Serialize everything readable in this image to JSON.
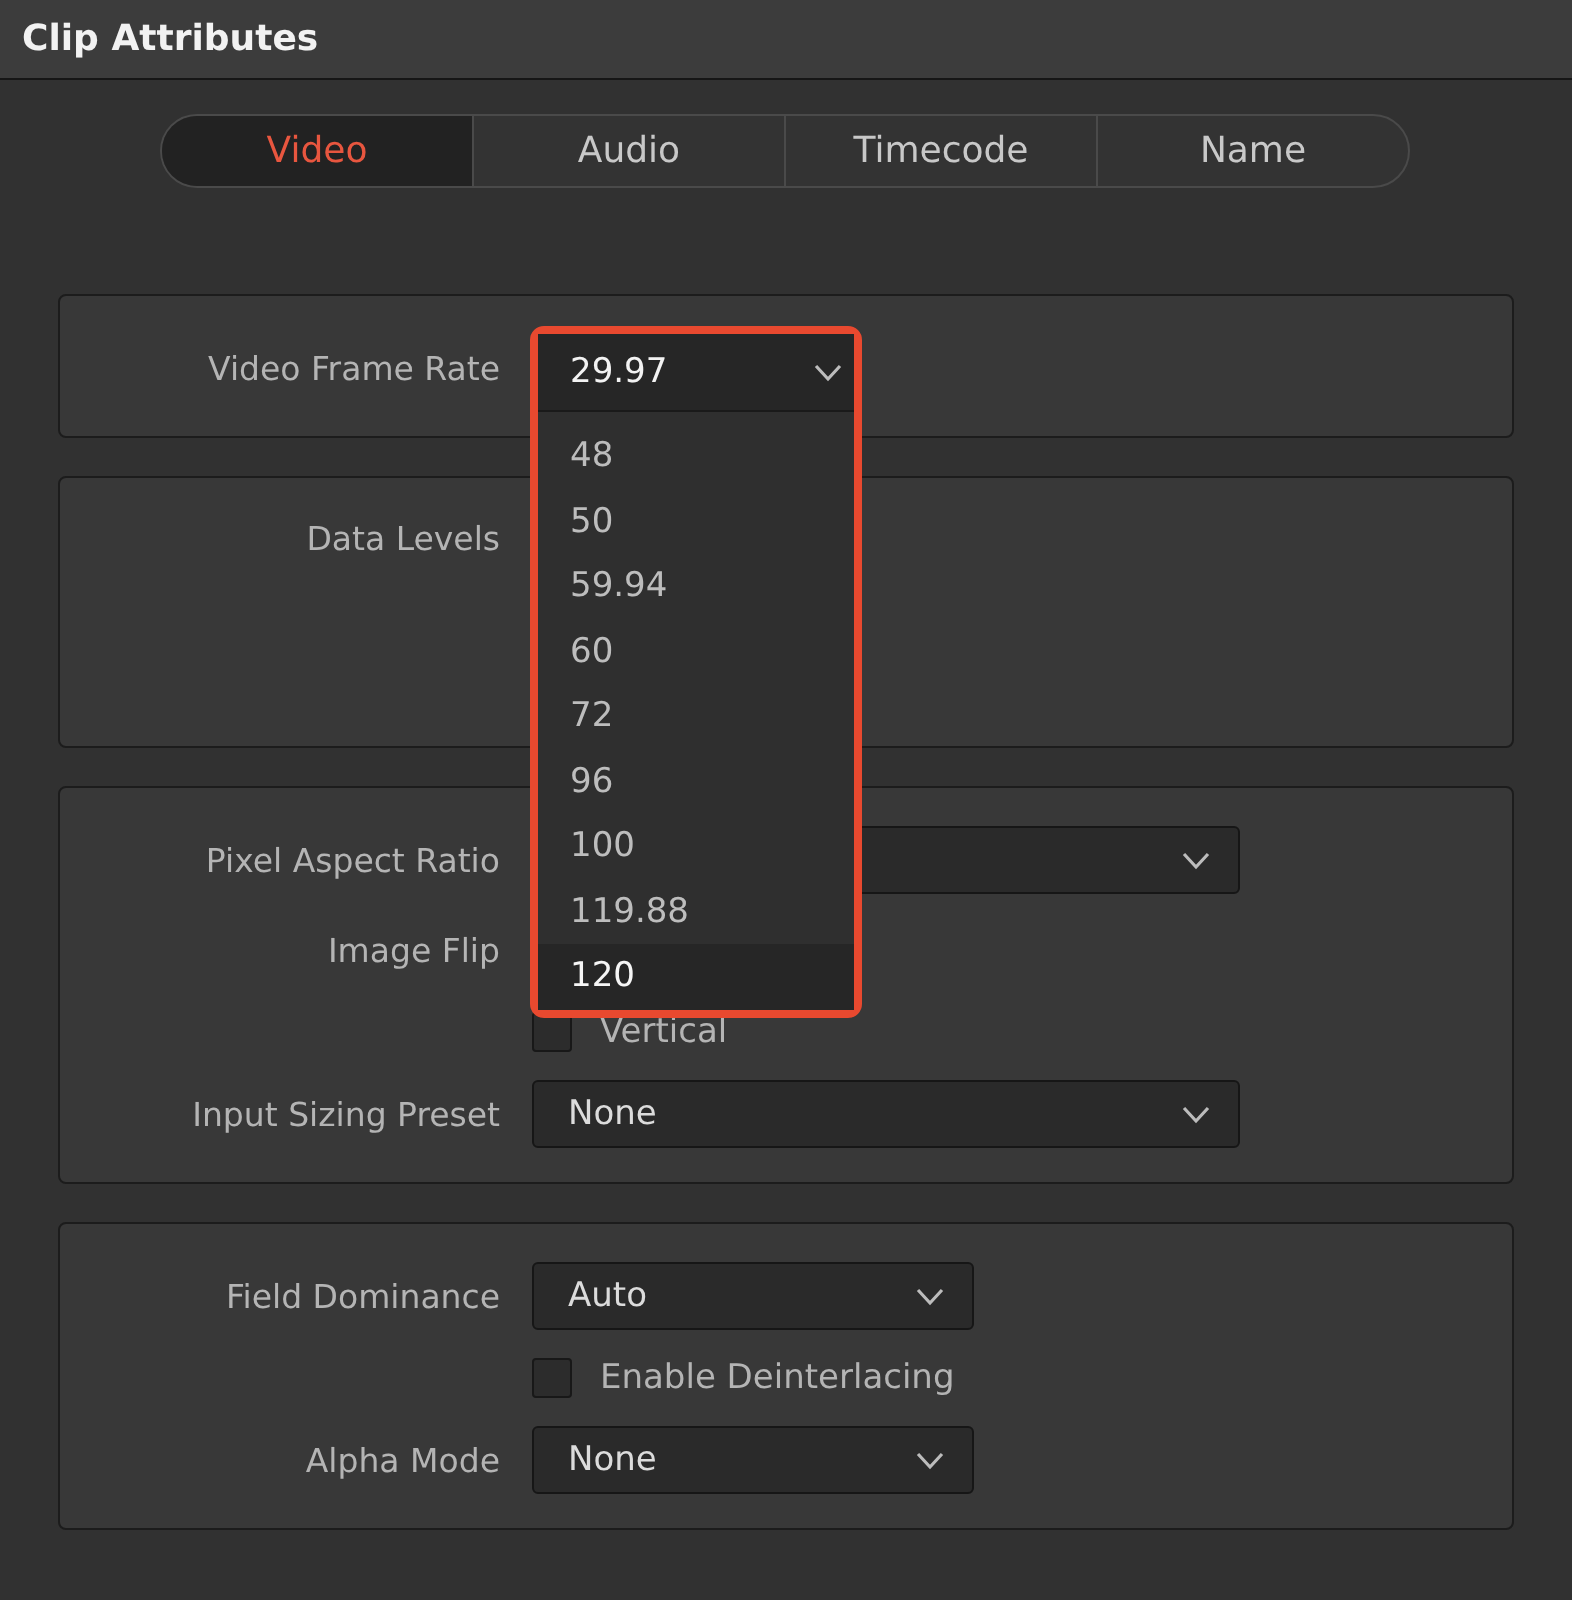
{
  "window": {
    "title": "Clip Attributes"
  },
  "tabs": [
    {
      "label": "Video",
      "selected": true
    },
    {
      "label": "Audio",
      "selected": false
    },
    {
      "label": "Timecode",
      "selected": false
    },
    {
      "label": "Name",
      "selected": false
    }
  ],
  "sections": [
    {
      "rows": [
        {
          "kind": "open-select",
          "label": "Video Frame Rate"
        }
      ]
    },
    {
      "rows": [
        {
          "kind": "label",
          "label": "Data Levels"
        }
      ]
    },
    {
      "rows": [
        {
          "kind": "select",
          "label": "Pixel Aspect Ratio"
        },
        {
          "kind": "label",
          "label": "Image Flip"
        },
        {
          "kind": "checkbox",
          "text": "Vertical",
          "checked": false
        },
        {
          "kind": "select",
          "label": "Input Sizing Preset",
          "value": "None"
        }
      ]
    },
    {
      "rows": [
        {
          "kind": "compact-select",
          "label": "Field Dominance",
          "value": "Auto"
        },
        {
          "kind": "checkbox",
          "text": "Enable Deinterlacing",
          "checked": false
        },
        {
          "kind": "compact-select",
          "label": "Alpha Mode",
          "value": "None"
        }
      ]
    }
  ],
  "frame_rate_dropdown": {
    "value": "29.97",
    "options": [
      {
        "label": "48",
        "selected": false
      },
      {
        "label": "50",
        "selected": false
      },
      {
        "label": "59.94",
        "selected": false
      },
      {
        "label": "60",
        "selected": false
      },
      {
        "label": "72",
        "selected": false
      },
      {
        "label": "96",
        "selected": false
      },
      {
        "label": "100",
        "selected": false
      },
      {
        "label": "119.88",
        "selected": false
      },
      {
        "label": "120",
        "selected": true
      }
    ]
  }
}
